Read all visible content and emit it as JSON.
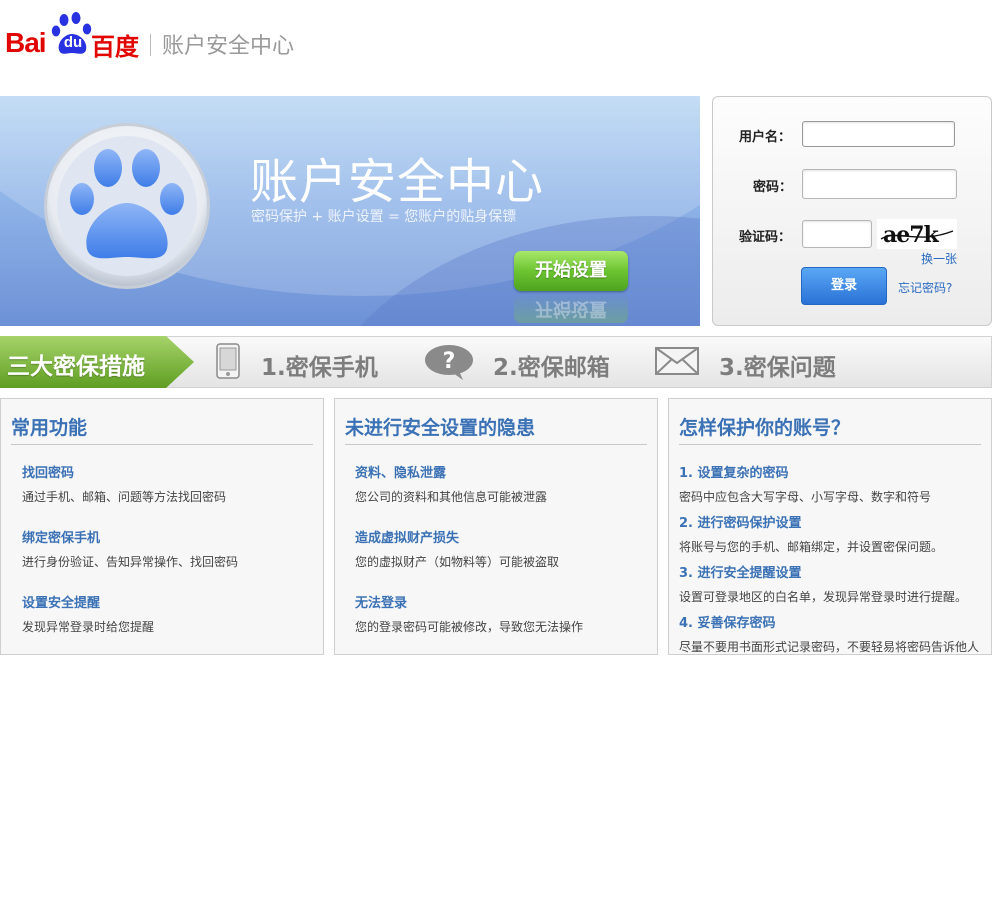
{
  "header": {
    "logo_bai": "Bai",
    "logo_du": "du",
    "logo_cn": "百度",
    "site_title": "账户安全中心"
  },
  "banner": {
    "title": "账户安全中心",
    "subtitle": "密码保护 + 账户设置 = 您账户的贴身保镖",
    "start_button": "开始设置"
  },
  "login": {
    "username_label": "用户名：",
    "password_label": "密码：",
    "captcha_label": "验证码：",
    "captcha_text": "ae7k",
    "username_value": "",
    "password_value": "",
    "captcha_value": "",
    "swap_link": "换一张",
    "login_button": "登录",
    "forgot_link": "忘记密码?"
  },
  "measures": {
    "tag": "三大密保措施",
    "items": [
      {
        "label": "1.密保手机",
        "icon": "phone-icon"
      },
      {
        "label": "2.密保邮箱",
        "icon": "question-bubble-icon"
      },
      {
        "label": "3.密保问题",
        "icon": "envelope-icon"
      }
    ]
  },
  "columns": [
    {
      "title": "常用功能",
      "items": [
        {
          "title": "找回密码",
          "desc": "通过手机、邮箱、问题等方法找回密码"
        },
        {
          "title": "绑定密保手机",
          "desc": "进行身份验证、告知异常操作、找回密码"
        },
        {
          "title": "设置安全提醒",
          "desc": "发现异常登录时给您提醒"
        }
      ]
    },
    {
      "title": "未进行安全设置的隐患",
      "items": [
        {
          "title": "资料、隐私泄露",
          "desc": "您公司的资料和其他信息可能被泄露"
        },
        {
          "title": "造成虚拟财产损失",
          "desc": "您的虚拟财产（如物料等）可能被盗取"
        },
        {
          "title": "无法登录",
          "desc": "您的登录密码可能被修改，导致您无法操作"
        }
      ]
    },
    {
      "title": "怎样保护你的账号？",
      "items": [
        {
          "title": "1. 设置复杂的密码",
          "desc": "密码中应包含大写字母、小写字母、数字和符号"
        },
        {
          "title": "2. 进行密码保护设置",
          "desc": "将账号与您的手机、邮箱绑定，并设置密保问题。"
        },
        {
          "title": "3. 进行安全提醒设置",
          "desc": "设置可登录地区的白名单，发现异常登录时进行提醒。"
        },
        {
          "title": "4. 妥善保存密码",
          "desc": "尽量不要用书面形式记录密码，不要轻易将密码告诉他人"
        }
      ]
    }
  ],
  "colors": {
    "brand_red": "#e10601",
    "brand_blue": "#2932e1",
    "link_blue": "#3b72b5",
    "button_green": "#6cc431",
    "tag_green": "#7cb83a"
  }
}
